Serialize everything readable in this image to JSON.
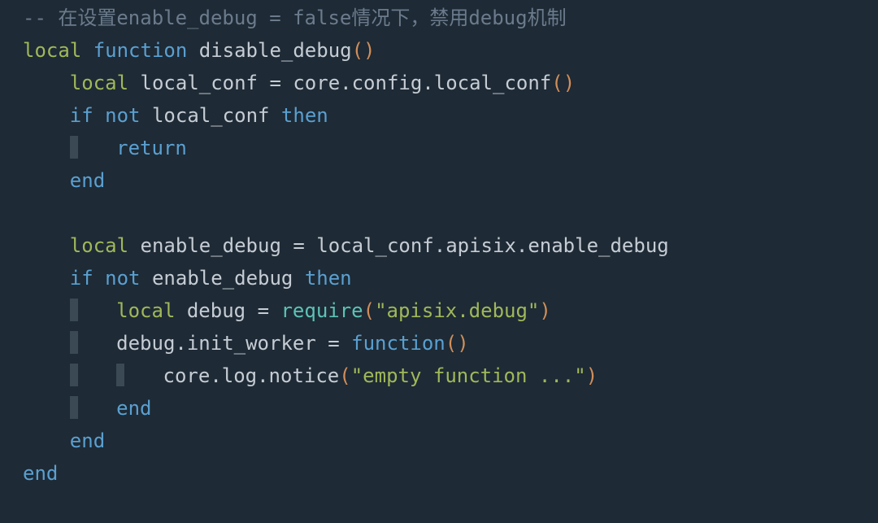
{
  "comment_prefix": "--",
  "comment_text": " 在设置enable_debug = false情况下，禁用debug机制",
  "kw_local": "local",
  "kw_function": "function",
  "kw_if": "if",
  "kw_not": "not",
  "kw_then": "then",
  "kw_return": "return",
  "kw_end": "end",
  "fn_disable_debug": "disable_debug",
  "var_local_conf": "local_conf",
  "call_local_conf": "core.config.local_conf",
  "var_enable_debug": "enable_debug",
  "path_enable_debug": "local_conf.apisix.enable_debug",
  "var_debug": "debug",
  "fn_require": "require",
  "str_apisix_debug": "\"apisix.debug\"",
  "path_init_worker": "debug.init_worker",
  "path_log_notice": "core.log.notice",
  "str_empty_fn": "\"empty function ...\"",
  "op_eq": "=",
  "pun_lp": "(",
  "pun_rp": ")",
  "pun_dot": "."
}
